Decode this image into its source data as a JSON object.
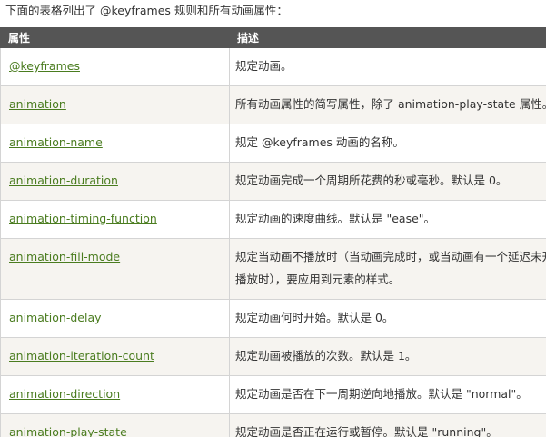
{
  "intro": "下面的表格列出了 @keyframes 规则和所有动画属性：",
  "headers": {
    "property": "属性",
    "description": "描述"
  },
  "rows": [
    {
      "property": "@keyframes",
      "description": "规定动画。"
    },
    {
      "property": "animation",
      "description": "所有动画属性的简写属性，除了 animation-play-state 属性。"
    },
    {
      "property": "animation-name",
      "description": "规定 @keyframes 动画的名称。"
    },
    {
      "property": "animation-duration",
      "description": "规定动画完成一个周期所花费的秒或毫秒。默认是 0。"
    },
    {
      "property": "animation-timing-function",
      "description": "规定动画的速度曲线。默认是 \"ease\"。"
    },
    {
      "property": "animation-fill-mode",
      "description": "规定当动画不播放时（当动画完成时，或当动画有一个延迟未开始播放时），要应用到元素的样式。"
    },
    {
      "property": "animation-delay",
      "description": "规定动画何时开始。默认是 0。"
    },
    {
      "property": "animation-iteration-count",
      "description": "规定动画被播放的次数。默认是 1。"
    },
    {
      "property": "animation-direction",
      "description": "规定动画是否在下一周期逆向地播放。默认是 \"normal\"。"
    },
    {
      "property": "animation-play-state",
      "description": "规定动画是否正在运行或暂停。默认是 \"running\"。"
    }
  ]
}
